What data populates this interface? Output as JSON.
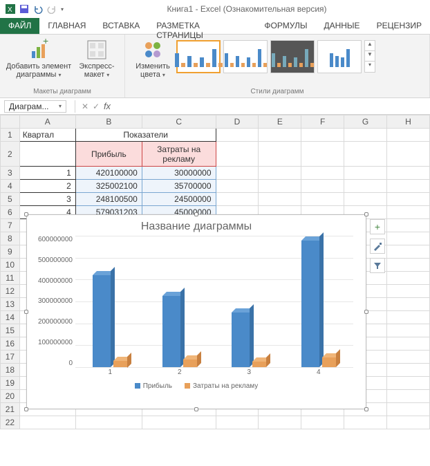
{
  "app": {
    "title": "Книга1 - Excel (Ознакомительная версия)"
  },
  "tabs": {
    "file": "ФАЙЛ",
    "home": "ГЛАВНАЯ",
    "insert": "ВСТАВКА",
    "layout": "РАЗМЕТКА СТРАНИЦЫ",
    "formulas": "ФОРМУЛЫ",
    "data": "ДАННЫЕ",
    "review": "РЕЦЕНЗИР"
  },
  "ribbon": {
    "add_element": "Добавить элемент диаграммы",
    "express": "Экспресс-макет",
    "change_colors": "Изменить цвета",
    "group1": "Макеты диаграмм",
    "group2": "Стили диаграмм"
  },
  "namebox": "Диаграм...",
  "sheet": {
    "cols": [
      "A",
      "B",
      "C",
      "D",
      "E",
      "F",
      "G",
      "H"
    ],
    "a1": "Квартал",
    "b1": "Показатели",
    "b2": "Прибыль",
    "c2": "Затраты на рекламу",
    "rows": [
      {
        "q": "1",
        "p": "420100000",
        "z": "30000000"
      },
      {
        "q": "2",
        "p": "325002100",
        "z": "35700000"
      },
      {
        "q": "3",
        "p": "248100500",
        "z": "24500000"
      },
      {
        "q": "4",
        "p": "579031203",
        "z": "45000000"
      }
    ]
  },
  "chart_data": {
    "type": "bar",
    "title": "Название диаграммы",
    "categories": [
      "1",
      "2",
      "3",
      "4"
    ],
    "series": [
      {
        "name": "Прибыль",
        "values": [
          420100000,
          325002100,
          248100500,
          579031203
        ],
        "color": "#4a8ac9"
      },
      {
        "name": "Затраты на рекламу",
        "values": [
          30000000,
          35700000,
          24500000,
          45000000
        ],
        "color": "#e8a05a"
      }
    ],
    "xlabel": "",
    "ylabel": "",
    "ylim": [
      0,
      600000000
    ],
    "yticks": [
      "0",
      "100000000",
      "200000000",
      "300000000",
      "400000000",
      "500000000",
      "600000000"
    ]
  },
  "chart_buttons": {
    "plus": "+",
    "brush": "✎",
    "filter": "▾"
  }
}
